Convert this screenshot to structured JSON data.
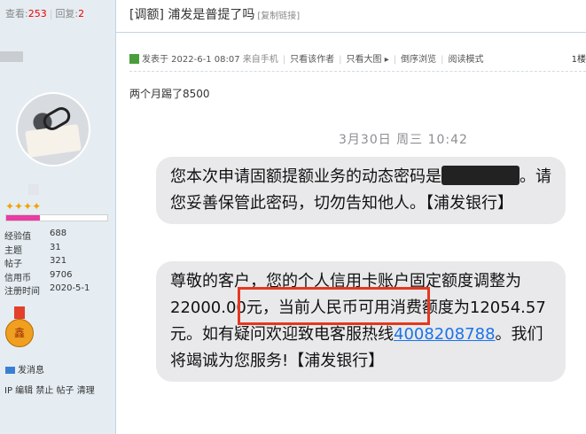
{
  "stats": {
    "views_label": "查看:",
    "views": "253",
    "replies_label": "回复:",
    "replies": "2"
  },
  "thread": {
    "title": "[调额] 浦发是普提了吗",
    "copy_link": "[复制链接]"
  },
  "user": {
    "stars": "✦✦✦✦",
    "progress": 0.33,
    "info": [
      {
        "key": "经验值",
        "value": "688"
      },
      {
        "key": "主题",
        "value": "31"
      },
      {
        "key": "帖子",
        "value": "321"
      },
      {
        "key": "信用币",
        "value": "9706"
      },
      {
        "key": "注册时间",
        "value": "2020-5-1"
      }
    ],
    "medal_text": "鑫",
    "send_message": "发消息",
    "ip_line": "IP 编辑 禁止 帖子 清理"
  },
  "post": {
    "posted": "发表于 2022-6-1 08:07",
    "from": "来自手机",
    "only_author": "只看该作者",
    "big_image": "只看大图",
    "reverse": "倒序浏览",
    "reader": "阅读模式",
    "floor": "1楼",
    "message": "两个月踢了8500"
  },
  "screenshot": {
    "date": "3月30日 周三 10:42",
    "sms1_a": "您本次申请固额提额业务的动态密码是",
    "sms1_b": "。请您妥善保管此密码，切勿告知他人。【浦发银行】",
    "sms2_a": "尊敬的客户，您的个人信用卡账户固定额度调整为22000.00元，当前人民币可用消费额度为12054.57元。如有疑问欢迎致电客服热线",
    "phone": "4008208788",
    "sms2_b": "。我们将竭诚为您服务!【浦发银行】"
  },
  "colors": {
    "sidebar_bg": "#e5edf2",
    "highlight": "#e5381f",
    "link": "#1a73e8"
  }
}
